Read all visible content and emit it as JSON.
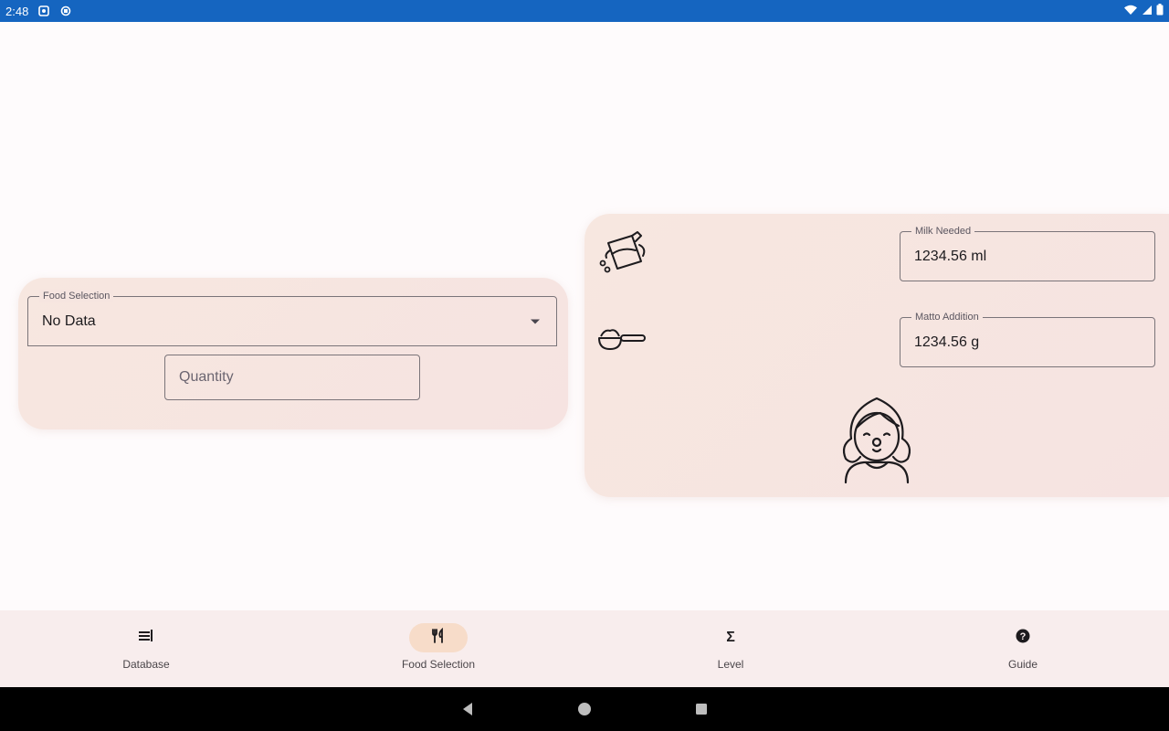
{
  "status_bar": {
    "time": "2:48",
    "icons_left": [
      "app-notification-icon",
      "sync-icon"
    ],
    "icons_right": [
      "wifi-icon",
      "signal-icon",
      "battery-icon"
    ]
  },
  "left_card": {
    "food_selection": {
      "label": "Food Selection",
      "value": "No Data"
    },
    "quantity": {
      "placeholder": "Quantity"
    }
  },
  "right_card": {
    "milk_field": {
      "label": "Milk Needed",
      "value": "1234.56 ml"
    },
    "matto_field": {
      "label": "Matto Addition",
      "value": "1234.56 g"
    },
    "icons": [
      "milk-jug-icon",
      "measuring-scoop-icon",
      "girl-face-icon"
    ]
  },
  "bottom_nav": {
    "items": [
      {
        "label": "Database",
        "icon": "database-icon",
        "active": false
      },
      {
        "label": "Food Selection",
        "icon": "fork-knife-icon",
        "active": true
      },
      {
        "label": "Level",
        "icon": "sigma-icon",
        "active": false
      },
      {
        "label": "Guide",
        "icon": "help-icon",
        "active": false
      }
    ]
  },
  "colors": {
    "status_bar": "#1565c0",
    "card_bg": "#f6e5e0",
    "active_indicator": "#f7dcc9",
    "system_nav": "#000000"
  }
}
